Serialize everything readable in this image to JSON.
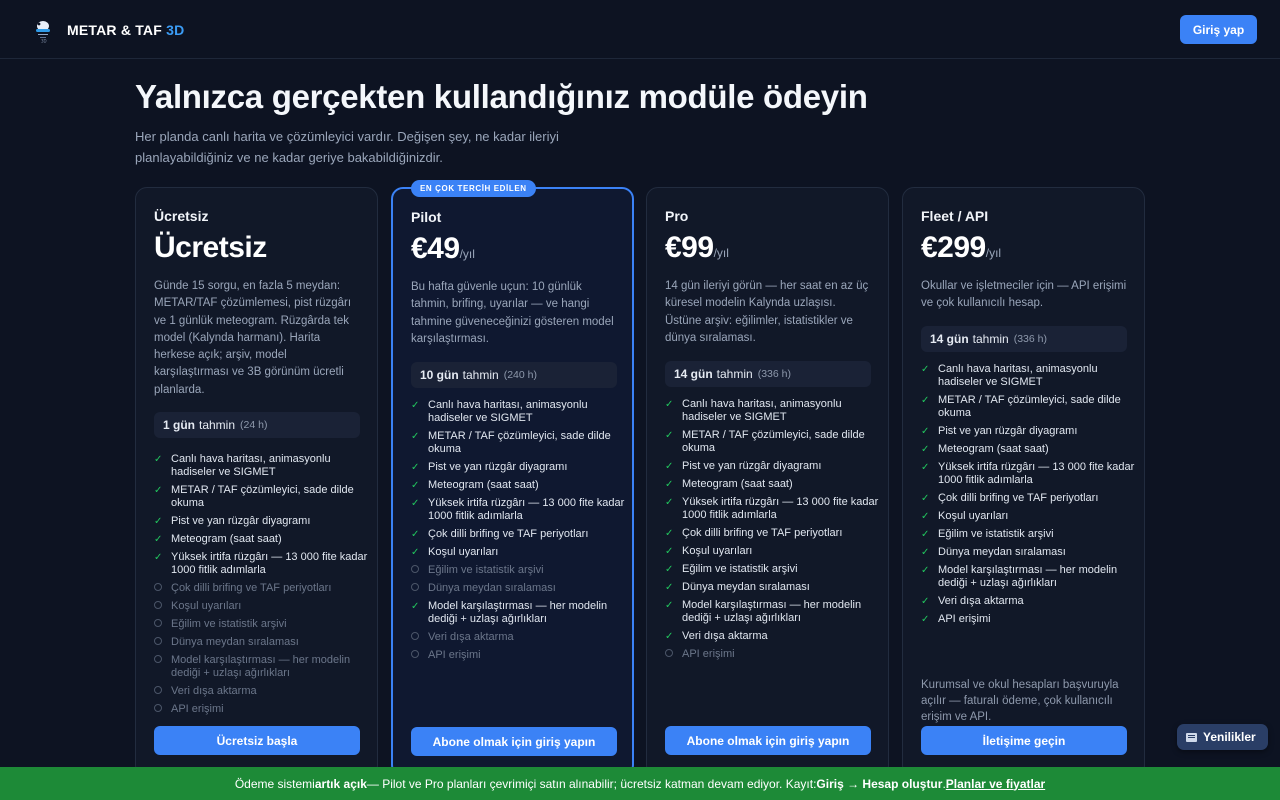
{
  "header": {
    "brand_main": "METAR & TAF",
    "brand_accent": "3D",
    "login_label": "Giriş yap"
  },
  "hero": {
    "title": "Yalnızca gerçekten kullandığınız modüle ödeyin",
    "subtitle": "Her planda canlı harita ve çözümleyici vardır. Değişen şey, ne kadar ileriyi planlayabildiğiniz ve ne kadar geriye bakabildiğinizdir."
  },
  "plans": [
    {
      "name": "Ücretsiz",
      "price": "Ücretsiz",
      "per": "",
      "description": "Günde 15 sorgu, en fazla 5 meydan: METAR/TAF çözümlemesi, pist rüzgârı ve 1 günlük meteogram. Rüzgârda tek model (Kalynda harmanı). Harita herkese açık; arşiv, model karşılaştırması ve 3B görünüm ücretli planlarda.",
      "forecast_days": "1 gün",
      "forecast_word": "tahmin",
      "forecast_hours": "(24 h)",
      "features": [
        {
          "text": "Canlı hava haritası, animasyonlu hadiseler ve SIGMET",
          "on": true
        },
        {
          "text": "METAR / TAF çözümleyici, sade dilde okuma",
          "on": true
        },
        {
          "text": "Pist ve yan rüzgâr diyagramı",
          "on": true
        },
        {
          "text": "Meteogram (saat saat)",
          "on": true
        },
        {
          "text": "Yüksek irtifa rüzgârı — 13 000 fite kadar 1000 fitlik adımlarla",
          "on": true
        },
        {
          "text": "Çok dilli brifing ve TAF periyotları",
          "on": false
        },
        {
          "text": "Koşul uyarıları",
          "on": false
        },
        {
          "text": "Eğilim ve istatistik arşivi",
          "on": false
        },
        {
          "text": "Dünya meydan sıralaması",
          "on": false
        },
        {
          "text": "Model karşılaştırması — her modelin dediği + uzlaşı ağırlıkları",
          "on": false
        },
        {
          "text": "Veri dışa aktarma",
          "on": false
        },
        {
          "text": "API erişimi",
          "on": false
        }
      ],
      "note": "",
      "cta": "Ücretsiz başla"
    },
    {
      "badge": "EN ÇOK TERCİH EDİLEN",
      "name": "Pilot",
      "price": "€49",
      "per": "/yıl",
      "description": "Bu hafta güvenle uçun: 10 günlük tahmin, brifing, uyarılar — ve hangi tahmine güveneceğinizi gösteren model karşılaştırması.",
      "forecast_days": "10 gün",
      "forecast_word": "tahmin",
      "forecast_hours": "(240 h)",
      "features": [
        {
          "text": "Canlı hava haritası, animasyonlu hadiseler ve SIGMET",
          "on": true
        },
        {
          "text": "METAR / TAF çözümleyici, sade dilde okuma",
          "on": true
        },
        {
          "text": "Pist ve yan rüzgâr diyagramı",
          "on": true
        },
        {
          "text": "Meteogram (saat saat)",
          "on": true
        },
        {
          "text": "Yüksek irtifa rüzgârı — 13 000 fite kadar 1000 fitlik adımlarla",
          "on": true
        },
        {
          "text": "Çok dilli brifing ve TAF periyotları",
          "on": true
        },
        {
          "text": "Koşul uyarıları",
          "on": true
        },
        {
          "text": "Eğilim ve istatistik arşivi",
          "on": false
        },
        {
          "text": "Dünya meydan sıralaması",
          "on": false
        },
        {
          "text": "Model karşılaştırması — her modelin dediği + uzlaşı ağırlıkları",
          "on": true
        },
        {
          "text": "Veri dışa aktarma",
          "on": false
        },
        {
          "text": "API erişimi",
          "on": false
        }
      ],
      "note": "",
      "cta": "Abone olmak için giriş yapın"
    },
    {
      "name": "Pro",
      "price": "€99",
      "per": "/yıl",
      "description": "14 gün ileriyi görün — her saat en az üç küresel modelin Kalynda uzlaşısı. Üstüne arşiv: eğilimler, istatistikler ve dünya sıralaması.",
      "forecast_days": "14 gün",
      "forecast_word": "tahmin",
      "forecast_hours": "(336 h)",
      "features": [
        {
          "text": "Canlı hava haritası, animasyonlu hadiseler ve SIGMET",
          "on": true
        },
        {
          "text": "METAR / TAF çözümleyici, sade dilde okuma",
          "on": true
        },
        {
          "text": "Pist ve yan rüzgâr diyagramı",
          "on": true
        },
        {
          "text": "Meteogram (saat saat)",
          "on": true
        },
        {
          "text": "Yüksek irtifa rüzgârı — 13 000 fite kadar 1000 fitlik adımlarla",
          "on": true
        },
        {
          "text": "Çok dilli brifing ve TAF periyotları",
          "on": true
        },
        {
          "text": "Koşul uyarıları",
          "on": true
        },
        {
          "text": "Eğilim ve istatistik arşivi",
          "on": true
        },
        {
          "text": "Dünya meydan sıralaması",
          "on": true
        },
        {
          "text": "Model karşılaştırması — her modelin dediği + uzlaşı ağırlıkları",
          "on": true
        },
        {
          "text": "Veri dışa aktarma",
          "on": true
        },
        {
          "text": "API erişimi",
          "on": false
        }
      ],
      "note": "",
      "cta": "Abone olmak için giriş yapın"
    },
    {
      "name": "Fleet / API",
      "price": "€299",
      "per": "/yıl",
      "description": "Okullar ve işletmeciler için — API erişimi ve çok kullanıcılı hesap.",
      "forecast_days": "14 gün",
      "forecast_word": "tahmin",
      "forecast_hours": "(336 h)",
      "features": [
        {
          "text": "Canlı hava haritası, animasyonlu hadiseler ve SIGMET",
          "on": true
        },
        {
          "text": "METAR / TAF çözümleyici, sade dilde okuma",
          "on": true
        },
        {
          "text": "Pist ve yan rüzgâr diyagramı",
          "on": true
        },
        {
          "text": "Meteogram (saat saat)",
          "on": true
        },
        {
          "text": "Yüksek irtifa rüzgârı — 13 000 fite kadar 1000 fitlik adımlarla",
          "on": true
        },
        {
          "text": "Çok dilli brifing ve TAF periyotları",
          "on": true
        },
        {
          "text": "Koşul uyarıları",
          "on": true
        },
        {
          "text": "Eğilim ve istatistik arşivi",
          "on": true
        },
        {
          "text": "Dünya meydan sıralaması",
          "on": true
        },
        {
          "text": "Model karşılaştırması — her modelin dediği + uzlaşı ağırlıkları",
          "on": true
        },
        {
          "text": "Veri dışa aktarma",
          "on": true
        },
        {
          "text": "API erişimi",
          "on": true
        }
      ],
      "note": "Kurumsal ve okul hesapları başvuruyla açılır — faturalı ödeme, çok kullanıcılı erişim ve API.",
      "cta": "İletişime geçin"
    }
  ],
  "news_button": {
    "label": "Yenilikler",
    "icon": "newspaper-icon"
  },
  "footer": {
    "part1": "Ödeme sistemi ",
    "bold1": "artık açık",
    "part2": " — Pilot ve Pro planları çevrimiçi satın alınabilir; ücretsiz katman devam ediyor. Kayıt: ",
    "bold2": "Giriş → Hesap oluştur",
    "part3": ". ",
    "link": "Planlar ve fiyatlar"
  },
  "colors": {
    "background": "#0d1322",
    "accent": "#3b82f6",
    "check": "#22c55e",
    "footer": "#1d8a37"
  }
}
